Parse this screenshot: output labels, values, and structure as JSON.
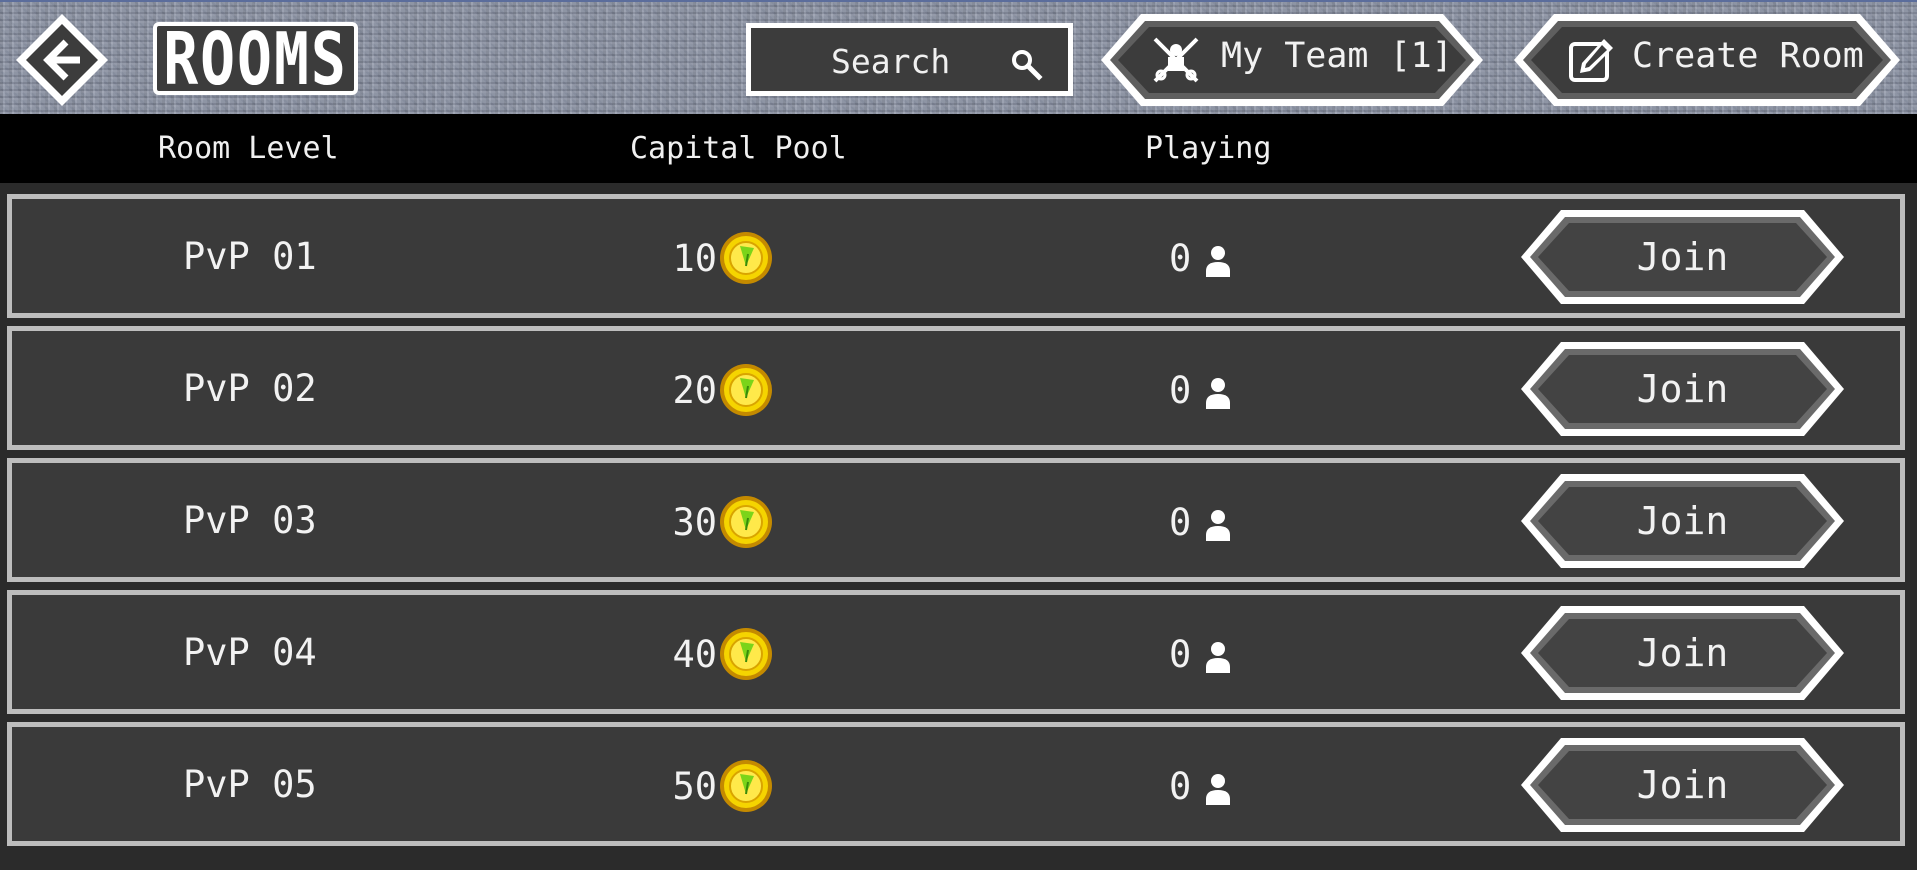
{
  "header": {
    "title": "ROOMS",
    "search": {
      "label": "Search",
      "icon": "search-icon"
    },
    "my_team": {
      "label": "My Team [1]",
      "icon": "crossed-swords-player-icon"
    },
    "create_room": {
      "label": "Create Room",
      "icon": "edit-icon"
    },
    "back": {
      "icon": "back-arrow-icon"
    }
  },
  "table": {
    "columns": [
      "Room Level",
      "Capital Pool",
      "Playing"
    ],
    "rows": [
      {
        "name": "PvP 01",
        "pool": "10",
        "playing": "0",
        "action": "Join"
      },
      {
        "name": "PvP 02",
        "pool": "20",
        "playing": "0",
        "action": "Join"
      },
      {
        "name": "PvP 03",
        "pool": "30",
        "playing": "0",
        "action": "Join"
      },
      {
        "name": "PvP 04",
        "pool": "40",
        "playing": "0",
        "action": "Join"
      },
      {
        "name": "PvP 05",
        "pool": "50",
        "playing": "0",
        "action": "Join"
      }
    ]
  },
  "colors": {
    "panel": "#3a3a3a",
    "row_border": "#bdbdbd",
    "header_bg": "#000000",
    "coin": "#f5d400",
    "coin_leaf": "#7bd419",
    "text": "#f2f2f2"
  }
}
